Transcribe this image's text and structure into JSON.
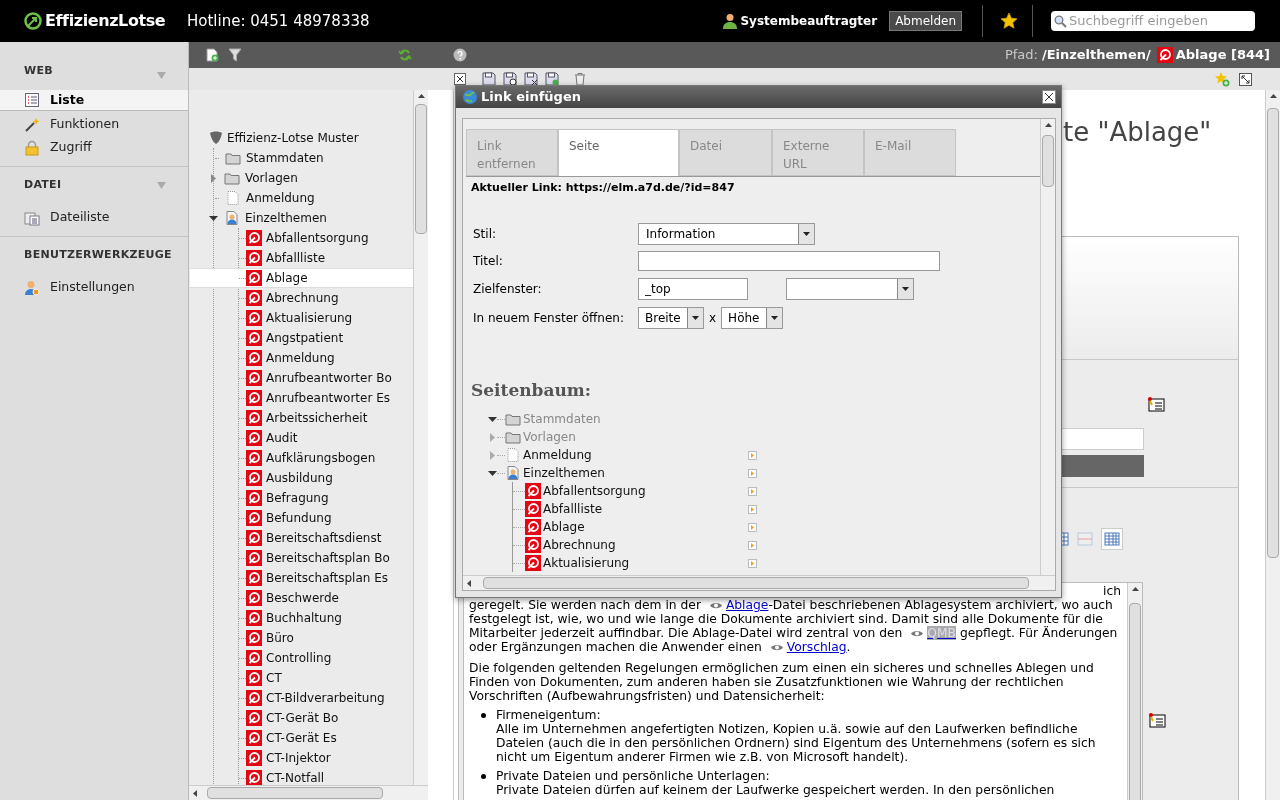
{
  "header": {
    "logo": "EffizienzLotse",
    "hotline": "Hotline: 0451 48978338",
    "user": "Systembeauftragter",
    "logout_button": "Abmelden",
    "search": {
      "placeholder": "Suchbegriff eingeben"
    }
  },
  "path_bar": {
    "label": "Pfad:",
    "folder": "/Einzelthemen/",
    "page": "Ablage [844]"
  },
  "sidebar": {
    "sections": [
      {
        "title": "WEB",
        "collapsible": true,
        "items": [
          {
            "label": "Liste",
            "kind": "list",
            "selected": true
          },
          {
            "label": "Funktionen",
            "kind": "wand",
            "selected": false
          },
          {
            "label": "Zugriff",
            "kind": "lock",
            "selected": false
          }
        ]
      },
      {
        "title": "DATEI",
        "collapsible": true,
        "items": [
          {
            "label": "Dateiliste",
            "kind": "files",
            "selected": false
          }
        ]
      },
      {
        "title": "BENUTZERWERKZEUGE",
        "collapsible": false,
        "items": [
          {
            "label": "Einstellungen",
            "kind": "user-settings",
            "selected": false
          }
        ]
      }
    ]
  },
  "page_tree": {
    "root": "Effizienz-Lotse Muster",
    "nodes": [
      {
        "label": "Stammdaten",
        "kind": "folder",
        "selected": false
      },
      {
        "label": "Vorlagen",
        "kind": "folder",
        "selected": false,
        "expanded": false
      },
      {
        "label": "Anmeldung",
        "kind": "page",
        "selected": false
      },
      {
        "label": "Einzelthemen",
        "kind": "user-page",
        "selected": false,
        "expanded": true,
        "children": [
          {
            "label": "Abfallentsorgung",
            "selected": false
          },
          {
            "label": "Abfallliste",
            "selected": false
          },
          {
            "label": "Ablage",
            "selected": true
          },
          {
            "label": "Abrechnung",
            "selected": false
          },
          {
            "label": "Aktualisierung",
            "selected": false
          },
          {
            "label": "Angstpatient",
            "selected": false
          },
          {
            "label": "Anmeldung",
            "selected": false
          },
          {
            "label": "Anrufbeantworter Bo",
            "selected": false
          },
          {
            "label": "Anrufbeantworter Es",
            "selected": false
          },
          {
            "label": "Arbeitssicherheit",
            "selected": false
          },
          {
            "label": "Audit",
            "selected": false
          },
          {
            "label": "Aufklärungsbogen",
            "selected": false
          },
          {
            "label": "Ausbildung",
            "selected": false
          },
          {
            "label": "Befragung",
            "selected": false
          },
          {
            "label": "Befundung",
            "selected": false
          },
          {
            "label": "Bereitschaftsdienst",
            "selected": false
          },
          {
            "label": "Bereitschaftsplan Bo",
            "selected": false
          },
          {
            "label": "Bereitschaftsplan Es",
            "selected": false
          },
          {
            "label": "Beschwerde",
            "selected": false
          },
          {
            "label": "Buchhaltung",
            "selected": false
          },
          {
            "label": "Büro",
            "selected": false
          },
          {
            "label": "Controlling",
            "selected": false
          },
          {
            "label": "CT",
            "selected": false
          },
          {
            "label": "CT-Bildverarbeitung",
            "selected": false
          },
          {
            "label": "CT-Gerät Bo",
            "selected": false
          },
          {
            "label": "CT-Gerät Es",
            "selected": false
          },
          {
            "label": "CT-Injektor",
            "selected": false
          },
          {
            "label": "CT-Notfall",
            "selected": false
          }
        ]
      }
    ]
  },
  "content": {
    "heading": "te \"Ablage\"",
    "fragment": "ich",
    "paragraphs": [
      [
        {
          "text": "geregelt. Sie werden nach dem in der "
        },
        {
          "link": "Ablage",
          "highlight": false
        },
        {
          "text": "-Datei beschriebenen Ablagesystem archiviert, wo auch festgelegt ist, wie, wo und wie lange die Dokumente archiviert sind. Damit sind alle Dokumente für die Mitarbeiter jederzeit auffindbar. Die Ablage-Datei wird zentral von den "
        },
        {
          "link": "QMB",
          "highlight": true
        },
        {
          "text": " gepflegt. Für Änderungen oder Ergänzungen machen die Anwender einen "
        },
        {
          "link": "Vorschlag",
          "highlight": false
        },
        {
          "text": "."
        }
      ],
      [
        {
          "text": "Die folgenden geltenden Regelungen ermöglichen zum einen ein sicheres und schnelles Ablegen und Finden von Dokumenten, zum anderen haben sie Zusatzfunktionen wie Wahrung der rechtlichen Vorschriften (Aufbewahrungsfristen) und Datensicherheit:"
        }
      ]
    ],
    "list": [
      {
        "title": "Firmeneigentum:",
        "text": "Alle im Unternehmen angefertigten Notizen, Kopien u.ä. sowie auf den Laufwerken befindliche Dateien (auch die in den persönlichen Ordnern) sind Eigentum des Unternehmens (sofern es sich nicht um Eigentum anderer Firmen wie z.B. von Microsoft handelt)."
      },
      {
        "title": "Private Dateien und persönliche Unterlagen:",
        "text": "Private Dateien dürfen auf keinem der Laufwerke gespeichert werden. In den persönlichen"
      }
    ]
  },
  "link_dialog": {
    "title": "Link einfügen",
    "tabs": [
      {
        "label": "Link entfernen",
        "selected": false
      },
      {
        "label": "Seite",
        "selected": true
      },
      {
        "label": "Datei",
        "selected": false
      },
      {
        "label": "Externe URL",
        "selected": false
      },
      {
        "label": "E-Mail",
        "selected": false
      }
    ],
    "current_link": "Aktueller Link: https://elm.a7d.de/?id=847",
    "form": {
      "style_label": "Stil:",
      "style_value": "Information",
      "title_label": "Titel:",
      "target_label": "Zielfenster:",
      "target_value": "_top",
      "new_window_label": "In neuem Fenster öffnen:",
      "width": "Breite",
      "separator": "x",
      "height": "Höhe"
    },
    "tree_title": "Seitenbaum:",
    "tree": [
      {
        "label": "Stammdaten",
        "kind": "folder",
        "expanded": true,
        "disabled": true
      },
      {
        "label": "Vorlagen",
        "kind": "folder",
        "expanded": false,
        "disabled": true
      },
      {
        "label": "Anmeldung",
        "kind": "page",
        "expanded": false,
        "disabled": false
      },
      {
        "label": "Einzelthemen",
        "kind": "user-page",
        "expanded": true,
        "disabled": false,
        "children": [
          {
            "label": "Abfallentsorgung",
            "disabled": false
          },
          {
            "label": "Abfallliste",
            "disabled": false
          },
          {
            "label": "Ablage",
            "disabled": false
          },
          {
            "label": "Abrechnung",
            "disabled": false
          },
          {
            "label": "Aktualisierung",
            "disabled": false
          }
        ]
      }
    ]
  }
}
